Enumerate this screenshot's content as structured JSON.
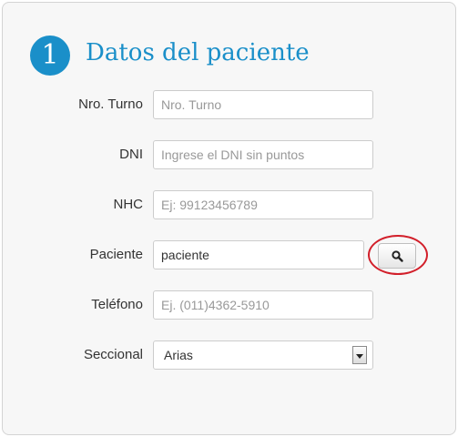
{
  "section": {
    "step_number": "1",
    "title": "Datos del paciente"
  },
  "form": {
    "turno": {
      "label": "Nro. Turno",
      "value": "",
      "placeholder": "Nro. Turno"
    },
    "dni": {
      "label": "DNI",
      "value": "",
      "placeholder": "Ingrese el DNI sin puntos"
    },
    "nhc": {
      "label": "NHC",
      "value": "",
      "placeholder": "Ej: 99123456789"
    },
    "paciente": {
      "label": "Paciente",
      "value": "paciente",
      "placeholder": ""
    },
    "telefono": {
      "label": "Teléfono",
      "value": "",
      "placeholder": "Ej. (011)4362-5910"
    },
    "seccional": {
      "label": "Seccional",
      "selected": "Arias"
    }
  },
  "icons": {
    "search_button": "search-icon",
    "select_arrow": "chevron-down-icon"
  },
  "colors": {
    "accent": "#1a8fc9",
    "annotation": "#d21f2a"
  }
}
